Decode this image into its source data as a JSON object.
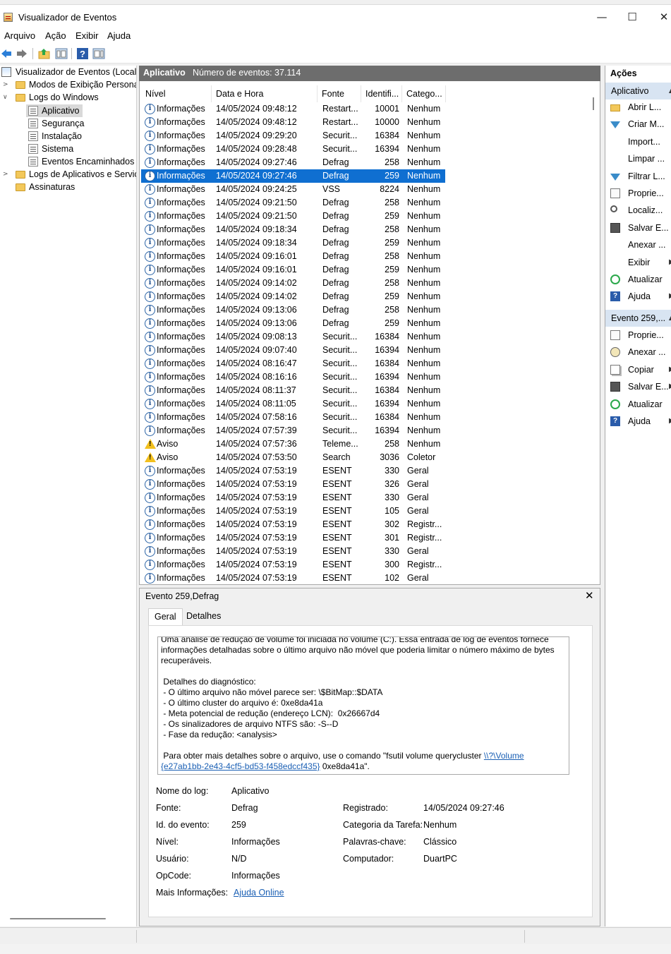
{
  "window": {
    "title": "Visualizador de Eventos",
    "minimize_glyph": "—",
    "maximize_glyph": "☐",
    "close_glyph": "✕"
  },
  "menu": [
    "Arquivo",
    "Ação",
    "Exibir",
    "Ajuda"
  ],
  "toolbar": {
    "icons": [
      "back-arrow-icon",
      "forward-arrow-icon",
      "up-folder-icon",
      "show-hide-tree-icon",
      "help-icon",
      "show-hide-action-pane-icon"
    ]
  },
  "tree": {
    "root": "Visualizador de Eventos (Local)",
    "custom_views": "Modos de Exibição Personali",
    "windows_logs": "Logs do Windows",
    "windows_logs_children": [
      "Aplicativo",
      "Segurança",
      "Instalação",
      "Sistema",
      "Eventos Encaminhados"
    ],
    "app_logs": "Logs de Aplicativos e Serviço",
    "subscriptions": "Assinaturas",
    "selected": "Aplicativo"
  },
  "list_header": {
    "log_name": "Aplicativo",
    "event_count": "Número de eventos: 37.114"
  },
  "columns": [
    "Nível",
    "Data e Hora",
    "Fonte",
    "Identifi...",
    "Catego..."
  ],
  "events": [
    {
      "level": "Informações",
      "icon": "info",
      "date": "14/05/2024 09:48:12",
      "source": "Restart...",
      "id": "10001",
      "category": "Nenhum"
    },
    {
      "level": "Informações",
      "icon": "info",
      "date": "14/05/2024 09:48:12",
      "source": "Restart...",
      "id": "10000",
      "category": "Nenhum"
    },
    {
      "level": "Informações",
      "icon": "info",
      "date": "14/05/2024 09:29:20",
      "source": "Securit...",
      "id": "16384",
      "category": "Nenhum"
    },
    {
      "level": "Informações",
      "icon": "info",
      "date": "14/05/2024 09:28:48",
      "source": "Securit...",
      "id": "16394",
      "category": "Nenhum"
    },
    {
      "level": "Informações",
      "icon": "info",
      "date": "14/05/2024 09:27:46",
      "source": "Defrag",
      "id": "258",
      "category": "Nenhum"
    },
    {
      "level": "Informações",
      "icon": "info",
      "date": "14/05/2024 09:27:46",
      "source": "Defrag",
      "id": "259",
      "category": "Nenhum",
      "selected": true
    },
    {
      "level": "Informações",
      "icon": "info",
      "date": "14/05/2024 09:24:25",
      "source": "VSS",
      "id": "8224",
      "category": "Nenhum"
    },
    {
      "level": "Informações",
      "icon": "info",
      "date": "14/05/2024 09:21:50",
      "source": "Defrag",
      "id": "258",
      "category": "Nenhum"
    },
    {
      "level": "Informações",
      "icon": "info",
      "date": "14/05/2024 09:21:50",
      "source": "Defrag",
      "id": "259",
      "category": "Nenhum"
    },
    {
      "level": "Informações",
      "icon": "info",
      "date": "14/05/2024 09:18:34",
      "source": "Defrag",
      "id": "258",
      "category": "Nenhum"
    },
    {
      "level": "Informações",
      "icon": "info",
      "date": "14/05/2024 09:18:34",
      "source": "Defrag",
      "id": "259",
      "category": "Nenhum"
    },
    {
      "level": "Informações",
      "icon": "info",
      "date": "14/05/2024 09:16:01",
      "source": "Defrag",
      "id": "258",
      "category": "Nenhum"
    },
    {
      "level": "Informações",
      "icon": "info",
      "date": "14/05/2024 09:16:01",
      "source": "Defrag",
      "id": "259",
      "category": "Nenhum"
    },
    {
      "level": "Informações",
      "icon": "info",
      "date": "14/05/2024 09:14:02",
      "source": "Defrag",
      "id": "258",
      "category": "Nenhum"
    },
    {
      "level": "Informações",
      "icon": "info",
      "date": "14/05/2024 09:14:02",
      "source": "Defrag",
      "id": "259",
      "category": "Nenhum"
    },
    {
      "level": "Informações",
      "icon": "info",
      "date": "14/05/2024 09:13:06",
      "source": "Defrag",
      "id": "258",
      "category": "Nenhum"
    },
    {
      "level": "Informações",
      "icon": "info",
      "date": "14/05/2024 09:13:06",
      "source": "Defrag",
      "id": "259",
      "category": "Nenhum"
    },
    {
      "level": "Informações",
      "icon": "info",
      "date": "14/05/2024 09:08:13",
      "source": "Securit...",
      "id": "16384",
      "category": "Nenhum"
    },
    {
      "level": "Informações",
      "icon": "info",
      "date": "14/05/2024 09:07:40",
      "source": "Securit...",
      "id": "16394",
      "category": "Nenhum"
    },
    {
      "level": "Informações",
      "icon": "info",
      "date": "14/05/2024 08:16:47",
      "source": "Securit...",
      "id": "16384",
      "category": "Nenhum"
    },
    {
      "level": "Informações",
      "icon": "info",
      "date": "14/05/2024 08:16:16",
      "source": "Securit...",
      "id": "16394",
      "category": "Nenhum"
    },
    {
      "level": "Informações",
      "icon": "info",
      "date": "14/05/2024 08:11:37",
      "source": "Securit...",
      "id": "16384",
      "category": "Nenhum"
    },
    {
      "level": "Informações",
      "icon": "info",
      "date": "14/05/2024 08:11:05",
      "source": "Securit...",
      "id": "16394",
      "category": "Nenhum"
    },
    {
      "level": "Informações",
      "icon": "info",
      "date": "14/05/2024 07:58:16",
      "source": "Securit...",
      "id": "16384",
      "category": "Nenhum"
    },
    {
      "level": "Informações",
      "icon": "info",
      "date": "14/05/2024 07:57:39",
      "source": "Securit...",
      "id": "16394",
      "category": "Nenhum"
    },
    {
      "level": "Aviso",
      "icon": "warn",
      "date": "14/05/2024 07:57:36",
      "source": "Teleme...",
      "id": "258",
      "category": "Nenhum"
    },
    {
      "level": "Aviso",
      "icon": "warn",
      "date": "14/05/2024 07:53:50",
      "source": "Search",
      "id": "3036",
      "category": "Coletor"
    },
    {
      "level": "Informações",
      "icon": "info",
      "date": "14/05/2024 07:53:19",
      "source": "ESENT",
      "id": "330",
      "category": "Geral"
    },
    {
      "level": "Informações",
      "icon": "info",
      "date": "14/05/2024 07:53:19",
      "source": "ESENT",
      "id": "326",
      "category": "Geral"
    },
    {
      "level": "Informações",
      "icon": "info",
      "date": "14/05/2024 07:53:19",
      "source": "ESENT",
      "id": "330",
      "category": "Geral"
    },
    {
      "level": "Informações",
      "icon": "info",
      "date": "14/05/2024 07:53:19",
      "source": "ESENT",
      "id": "105",
      "category": "Geral"
    },
    {
      "level": "Informações",
      "icon": "info",
      "date": "14/05/2024 07:53:19",
      "source": "ESENT",
      "id": "302",
      "category": "Registr..."
    },
    {
      "level": "Informações",
      "icon": "info",
      "date": "14/05/2024 07:53:19",
      "source": "ESENT",
      "id": "301",
      "category": "Registr..."
    },
    {
      "level": "Informações",
      "icon": "info",
      "date": "14/05/2024 07:53:19",
      "source": "ESENT",
      "id": "330",
      "category": "Geral"
    },
    {
      "level": "Informações",
      "icon": "info",
      "date": "14/05/2024 07:53:19",
      "source": "ESENT",
      "id": "300",
      "category": "Registr..."
    },
    {
      "level": "Informações",
      "icon": "info",
      "date": "14/05/2024 07:53:19",
      "source": "ESENT",
      "id": "102",
      "category": "Geral"
    }
  ],
  "detail": {
    "title": "Evento 259,Defrag",
    "close_glyph": "✕",
    "tabs": [
      "Geral",
      "Detalhes"
    ],
    "active_tab": "Geral",
    "description_lines": [
      "Uma análise de redução de volume foi iniciada no volume (C:). Essa entrada de log de eventos fornece",
      "informações detalhadas sobre o último arquivo não móvel que poderia limitar o número máximo de bytes",
      "recuperáveis.",
      "",
      " Detalhes do diagnóstico:",
      " - O último arquivo não móvel parece ser: \\$BitMap::$DATA",
      " - O último cluster do arquivo é: 0xe8da41a",
      " - Meta potencial de redução (endereço LCN):  0x26667d4",
      " - Os sinalizadores de arquivo NTFS são: -S--D",
      " - Fase da redução: <analysis>",
      ""
    ],
    "description_tail_prefix": " Para obter mais detalhes sobre o arquivo, use o comando \"fsutil volume querycluster ",
    "description_link_1": "\\\\?\\Volume",
    "description_link_2": "{e27ab1bb-2e43-4cf5-bd53-f458edccf435}",
    "description_tail_suffix": " 0xe8da41a\".",
    "props": {
      "log_name_label": "Nome do log:",
      "log_name_value": "Aplicativo",
      "source_label": "Fonte:",
      "source_value": "Defrag",
      "event_id_label": "Id. do evento:",
      "event_id_value": "259",
      "level_label": "Nível:",
      "level_value": "Informações",
      "user_label": "Usuário:",
      "user_value": "N/D",
      "opcode_label": "OpCode:",
      "opcode_value": "Informações",
      "more_info_label": "Mais Informações:",
      "more_info_link": "Ajuda Online",
      "logged_label": "Registrado:",
      "logged_value": "14/05/2024 09:27:46",
      "task_label": "Categoria da Tarefa:",
      "task_value": "Nenhum",
      "keywords_label": "Palavras-chave:",
      "keywords_value": "Clássico",
      "computer_label": "Computador:",
      "computer_value": "DuartPC"
    }
  },
  "actions": {
    "title": "Ações",
    "section1": "Aplicativo",
    "items1": [
      {
        "label": "Abrir L...",
        "icon": "open-log-icon"
      },
      {
        "label": "Criar M...",
        "icon": "create-view-icon"
      },
      {
        "label": "Import...",
        "icon": ""
      },
      {
        "label": "Limpar ...",
        "icon": ""
      },
      {
        "label": "Filtrar L...",
        "icon": "filter-icon"
      },
      {
        "label": "Proprie...",
        "icon": "properties-icon"
      },
      {
        "label": "Localiz...",
        "icon": "find-icon"
      },
      {
        "label": "Salvar E...",
        "icon": "save-icon"
      },
      {
        "label": "Anexar ...",
        "icon": ""
      },
      {
        "label": "Exibir",
        "icon": ""
      },
      {
        "label": "Atualizar",
        "icon": "refresh-icon"
      },
      {
        "label": "Ajuda",
        "icon": "help-icon"
      }
    ],
    "section2": "Evento 259,...",
    "items2": [
      {
        "label": "Proprie...",
        "icon": "properties-icon"
      },
      {
        "label": "Anexar ...",
        "icon": "attach-task-icon"
      },
      {
        "label": "Copiar",
        "icon": "copy-icon"
      },
      {
        "label": "Salvar E...",
        "icon": "save-icon"
      },
      {
        "label": "Atualizar",
        "icon": "refresh-icon"
      },
      {
        "label": "Ajuda",
        "icon": "help-icon"
      }
    ],
    "submenu_arrow": "▶"
  },
  "colors": {
    "selection": "#0f6fd1",
    "pane_header": "#6d6d6d",
    "action_section": "#d8e4f2",
    "link": "#1a5fb4"
  }
}
